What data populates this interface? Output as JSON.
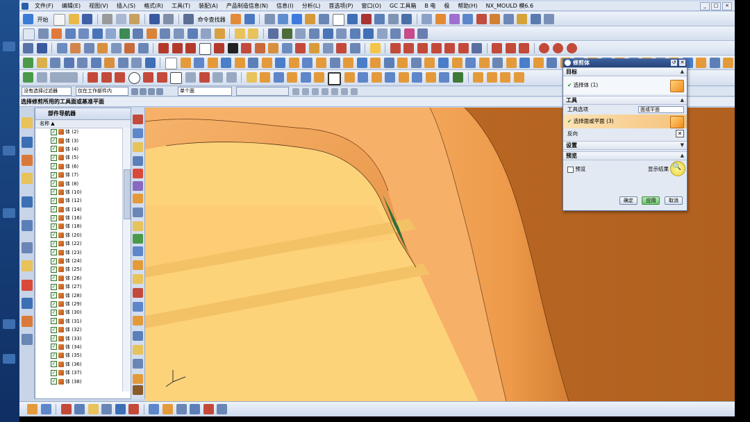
{
  "window": {
    "title": "NX_MOULD 模6.6",
    "controls": [
      "_",
      "□",
      "×"
    ]
  },
  "menu": [
    "文件(F)",
    "编辑(E)",
    "视图(V)",
    "插入(S)",
    "格式(R)",
    "工具(T)",
    "装配(A)",
    "产品制造信息(N)",
    "信息(I)",
    "分析(L)",
    "首选项(P)",
    "窗口(O)",
    "GC 工具箱",
    "B 电",
    "极",
    "帮助(H)",
    "NX_MOULD 模6.6"
  ],
  "toolbar": {
    "start_label": "开始",
    "command_finder_label": "命令查找器"
  },
  "selection_bar": {
    "filter": "没有选择过滤器",
    "scope": "仅在工作部件内",
    "face_rule": "单个面"
  },
  "cue_line": "选择修剪所用的工具面或基准平面",
  "navigator": {
    "title": "部件导航器",
    "column": "名称",
    "items": [
      "体 (2)",
      "体 (3)",
      "体 (4)",
      "体 (5)",
      "体 (6)",
      "体 (7)",
      "体 (8)",
      "体 (10)",
      "体 (12)",
      "体 (14)",
      "体 (16)",
      "体 (18)",
      "体 (20)",
      "体 (22)",
      "体 (23)",
      "体 (24)",
      "体 (25)",
      "体 (26)",
      "体 (27)",
      "体 (28)",
      "体 (29)",
      "体 (30)",
      "体 (31)",
      "体 (32)",
      "体 (33)",
      "体 (34)",
      "体 (35)",
      "体 (36)",
      "体 (37)",
      "体 (38)"
    ]
  },
  "dialog": {
    "title": "修剪体",
    "target_header": "目标",
    "target_select": "选择体 (1)",
    "tool_header": "工具",
    "tool_option_label": "工具选项",
    "tool_option_value": "面或平面",
    "tool_select": "选择面或平面 (3)",
    "reverse_label": "反向",
    "settings_header": "设置",
    "preview_header": "预览",
    "preview_checkbox": "预览",
    "show_result": "显示结果",
    "ok": "确定",
    "apply": "应用",
    "cancel": "取消"
  },
  "colors": {
    "check_green": "#1a8a1a",
    "dialog_title": "#2c4b84",
    "model_orange": "#f0a04e",
    "model_yellow": "#fdd37a",
    "model_brown": "#b8672a",
    "section_green": "#2f6e3a"
  }
}
